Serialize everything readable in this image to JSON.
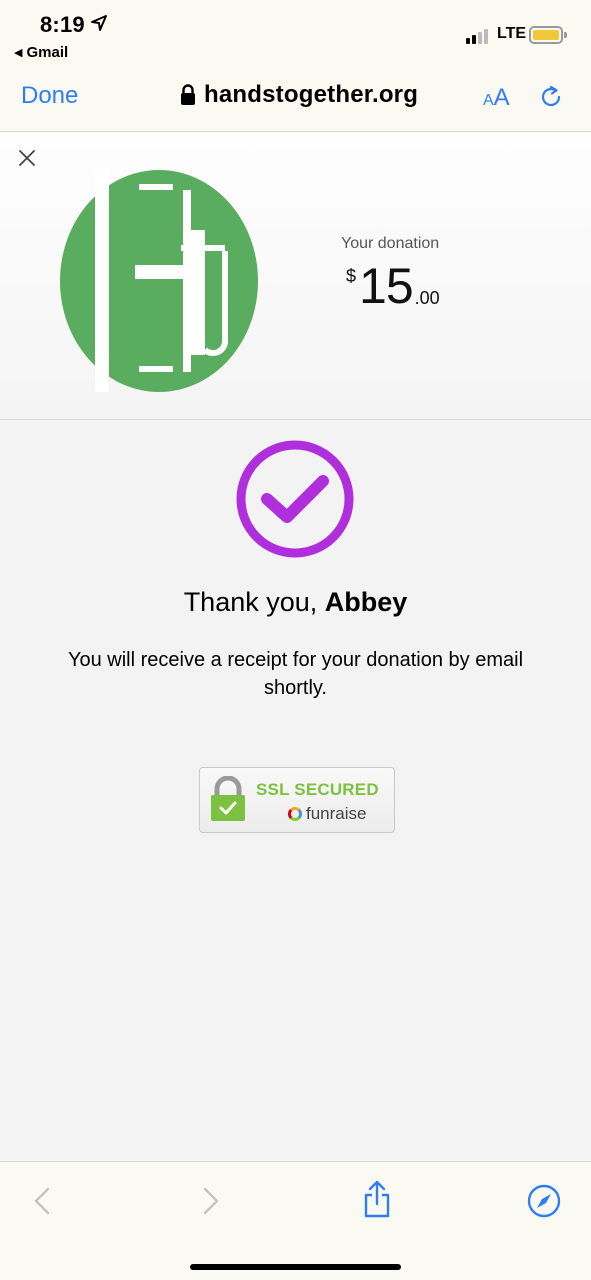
{
  "status_bar": {
    "time": "8:19",
    "back_app": "Gmail",
    "network": "LTE"
  },
  "browser": {
    "done_label": "Done",
    "url": "handstogether.org",
    "aa_label_small": "A",
    "aa_label_large": "A"
  },
  "donation": {
    "label": "Your donation",
    "currency_symbol": "$",
    "amount_whole": "15",
    "amount_cents": ".00"
  },
  "confirmation": {
    "thanks_prefix": "Thank you, ",
    "donor_name": "Abbey",
    "receipt_message": "You will receive a receipt for your donation by email shortly."
  },
  "badge": {
    "ssl_text": "SSL SECURED",
    "brand_text": "funraise"
  },
  "colors": {
    "accent_blue": "#2f7df6",
    "logo_green": "#5aad5e",
    "check_purple": "#b02fdc",
    "ssl_green": "#7cc140"
  }
}
